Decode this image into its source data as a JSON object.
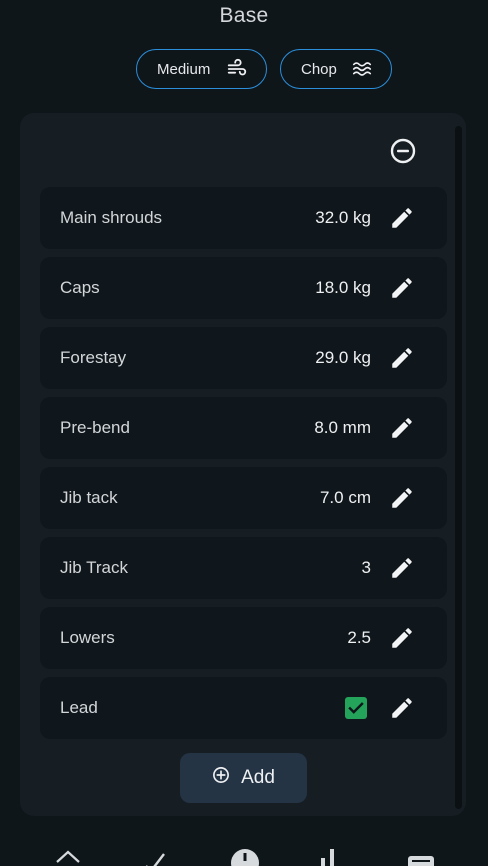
{
  "header": {
    "title": "Base"
  },
  "conditions": {
    "wind": {
      "label": "Medium",
      "icon": "wind-icon"
    },
    "sea": {
      "label": "Chop",
      "icon": "waves-icon"
    }
  },
  "settings": {
    "collapse_icon": "minus-circle-icon",
    "edit_icon": "pencil-icon",
    "rows": [
      {
        "label": "Main shrouds",
        "value": "32.0 kg"
      },
      {
        "label": "Caps",
        "value": "18.0 kg"
      },
      {
        "label": "Forestay",
        "value": "29.0 kg"
      },
      {
        "label": "Pre-bend",
        "value": "8.0 mm"
      },
      {
        "label": "Jib tack",
        "value": "7.0 cm"
      },
      {
        "label": "Jib Track",
        "value": "3"
      },
      {
        "label": "Lowers",
        "value": "2.5"
      },
      {
        "label": "Lead",
        "checked": true
      }
    ],
    "add_label": "Add"
  },
  "bottom_nav": {
    "items": [
      "home-icon",
      "checklist-icon",
      "add-circle-icon",
      "chart-icon",
      "notes-icon"
    ]
  },
  "colors": {
    "background": "#0f161a",
    "card": "#161e24",
    "row": "#10171c",
    "chip_border": "#2b8fdb",
    "checkbox": "#23a45a",
    "add_button": "#243445"
  }
}
